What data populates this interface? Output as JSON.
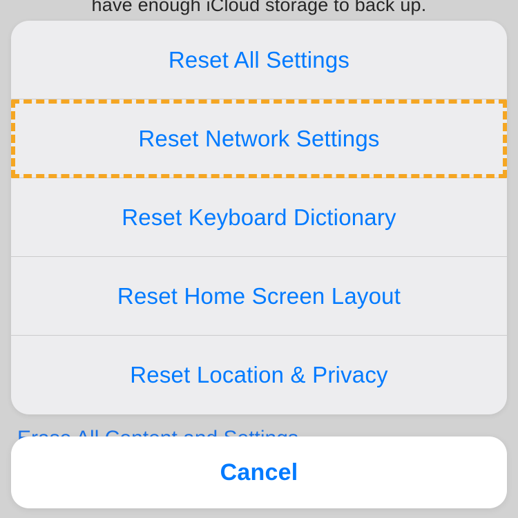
{
  "background": {
    "top_text": "have enough iCloud storage to back up.",
    "erase_row": "Erase All Content and Settings"
  },
  "sheet": {
    "options": [
      {
        "label": "Reset All Settings"
      },
      {
        "label": "Reset Network Settings"
      },
      {
        "label": "Reset Keyboard Dictionary"
      },
      {
        "label": "Reset Home Screen Layout"
      },
      {
        "label": "Reset Location & Privacy"
      }
    ],
    "cancel": "Cancel"
  }
}
